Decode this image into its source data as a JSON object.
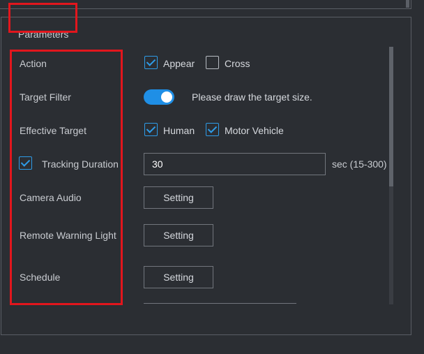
{
  "section": {
    "legend": "Parameters"
  },
  "rows": {
    "action": {
      "label": "Action",
      "options": [
        {
          "label": "Appear",
          "checked": true
        },
        {
          "label": "Cross",
          "checked": false
        }
      ]
    },
    "target_filter": {
      "label": "Target Filter",
      "enabled": true,
      "hint": "Please draw the target size."
    },
    "effective_target": {
      "label": "Effective Target",
      "options": [
        {
          "label": "Human",
          "checked": true
        },
        {
          "label": "Motor Vehicle",
          "checked": true
        }
      ]
    },
    "tracking_duration": {
      "label": "Tracking Duration",
      "checked": true,
      "value": "30",
      "unit": "sec (15-300)"
    },
    "camera_audio": {
      "label": "Camera Audio",
      "button": "Setting"
    },
    "remote_warning_light": {
      "label": "Remote Warning Light",
      "button": "Setting"
    },
    "schedule": {
      "label": "Schedule",
      "button": "Setting"
    }
  },
  "colors": {
    "accent": "#2e9ce8",
    "toggle_on": "#1f8fe6",
    "highlight": "#e2161d",
    "background": "#2b2e33"
  }
}
